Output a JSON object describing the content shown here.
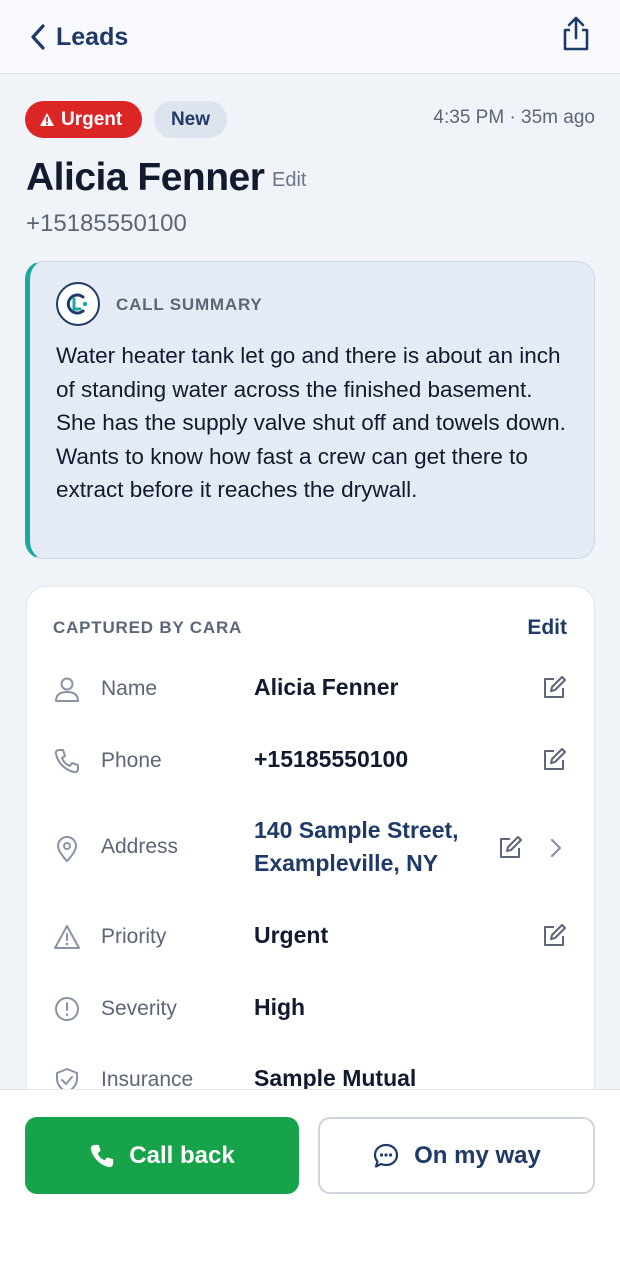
{
  "header": {
    "back_label": "Leads",
    "back_icon": "chevron-left-icon",
    "share_icon": "share-icon"
  },
  "status": {
    "urgent_badge": "Urgent",
    "new_badge": "New",
    "time": "4:35 PM · 35m ago"
  },
  "lead": {
    "name": "Alicia Fenner",
    "edit_label": "Edit",
    "phone": "+15185550100"
  },
  "summary": {
    "label": "CALL SUMMARY",
    "text": "Water heater tank let go and there is about an inch of standing water across the finished basement. She has the supply valve shut off and towels down. Wants to know how fast a crew can get there to extract before it reaches the drywall."
  },
  "captured": {
    "label": "CAPTURED BY CARA",
    "edit_label": "Edit",
    "fields": [
      {
        "label": "Name",
        "value": "Alicia Fenner",
        "icon": "person-icon"
      },
      {
        "label": "Phone",
        "value": "+15185550100",
        "icon": "phone-icon"
      },
      {
        "label": "Address",
        "value_line1": "140 Sample Street,",
        "value_line2": "Exampleville, NY",
        "icon": "map-pin-icon"
      },
      {
        "label": "Priority",
        "value": "Urgent",
        "icon": "warning-triangle-icon"
      },
      {
        "label": "Severity",
        "value": "High",
        "icon": "alert-circle-icon"
      },
      {
        "label": "Insurance",
        "value": "Sample Mutual",
        "icon": "shield-check-icon"
      }
    ]
  },
  "actions": {
    "call_back": "Call back",
    "on_my_way": "On my way"
  },
  "colors": {
    "accent": "#1f3a68",
    "urgent": "#dc2626",
    "call_green": "#16a34a",
    "summary_bar": "#1aa8a2"
  }
}
